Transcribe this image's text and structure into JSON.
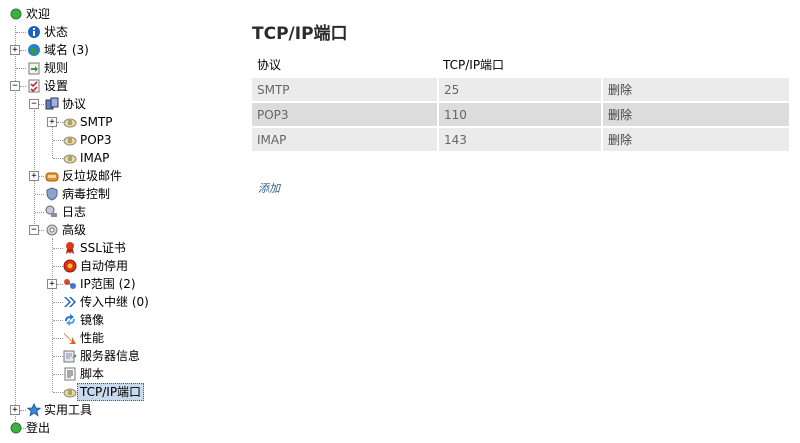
{
  "tree": {
    "welcome": "欢迎",
    "status": "状态",
    "domains": "域名 (3)",
    "rules": "规则",
    "settings": "设置",
    "protocols": "协议",
    "smtp": "SMTP",
    "pop3": "POP3",
    "imap": "IMAP",
    "antispam": "反垃圾邮件",
    "antivirus": "病毒控制",
    "logging": "日志",
    "advanced": "高级",
    "ssl": "SSL证书",
    "autoban": "自动停用",
    "ip_ranges": "IP范围 (2)",
    "incoming_relays": "传入中继 (0)",
    "mirror": "镜像",
    "performance": "性能",
    "server_message": "服务器信息",
    "scripts": "脚本",
    "tcpip": "TCP/IP端口",
    "utilities": "实用工具",
    "logout": "登出",
    "expander_plus": "+",
    "expander_minus": "−"
  },
  "main": {
    "title": "TCP/IP端口",
    "columns": [
      "协议",
      "TCP/IP端口",
      ""
    ],
    "rows": [
      {
        "protocol": "SMTP",
        "port": "25",
        "action": "删除"
      },
      {
        "protocol": "POP3",
        "port": "110",
        "action": "删除"
      },
      {
        "protocol": "IMAP",
        "port": "143",
        "action": "删除"
      }
    ],
    "add_label": "添加"
  },
  "colors": {
    "row_light": "#ebebeb",
    "row_dark": "#dcdcdc",
    "selected_bg": "#c9d9ee",
    "link": "#2d5c8a"
  }
}
